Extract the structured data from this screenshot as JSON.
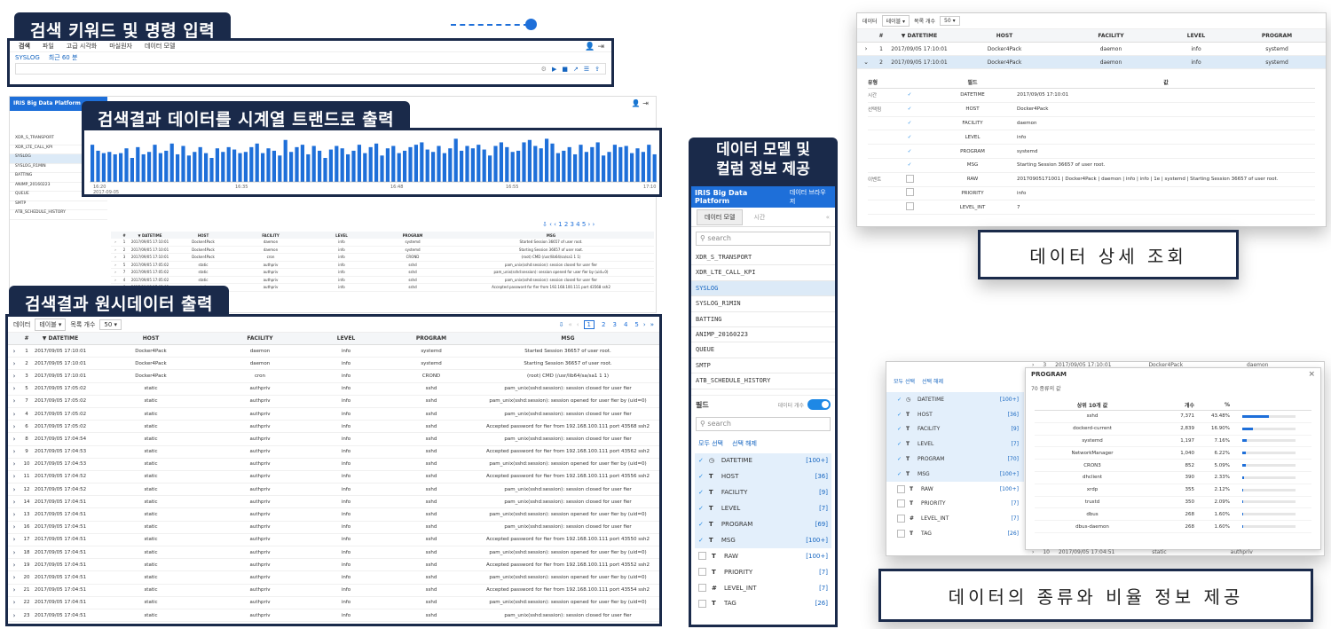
{
  "labels": {
    "search_keyword": "검색 키워드 및 명령 입력",
    "timeseries": "검색결과 데이터를 시계열 트랜드로 출력",
    "raw_output": "검색결과 원시데이터 출력",
    "data_model": "데이터 모델 및\n컬럼 정보 제공",
    "detail_view": "데이터 상세 조회",
    "ratio_info": "데이터의 종류와 비율 정보 제공"
  },
  "search_bar": {
    "menu": [
      "검색",
      "파일",
      "고급 시각화",
      "마실원자",
      "데이터 모델"
    ],
    "tabs": [
      "SYSLOG",
      "최근 60 분"
    ]
  },
  "chart_data": {
    "type": "bar",
    "title": "",
    "x_ticks": [
      "16:20\n2017-09-05",
      "16:35",
      "16:48",
      "16:55",
      "17:10"
    ],
    "values": [
      62,
      52,
      48,
      50,
      46,
      48,
      56,
      40,
      58,
      46,
      50,
      62,
      48,
      52,
      64,
      46,
      60,
      44,
      50,
      58,
      48,
      40,
      56,
      50,
      58,
      54,
      48,
      50,
      58,
      64,
      48,
      56,
      52,
      44,
      70,
      50,
      58,
      62,
      46,
      60,
      52,
      40,
      54,
      60,
      56,
      46,
      52,
      62,
      48,
      58,
      64,
      44,
      56,
      60,
      48,
      52,
      58,
      62,
      66,
      54,
      50,
      60,
      48,
      56,
      72,
      52,
      60,
      56,
      62,
      54,
      44,
      60,
      66,
      58,
      50,
      52,
      66,
      70,
      60,
      56,
      72,
      64,
      48,
      52,
      58,
      46,
      62,
      50,
      58,
      66,
      44,
      50,
      62,
      58,
      60,
      48,
      56,
      50,
      62,
      46
    ],
    "ylim": [
      0,
      80
    ]
  },
  "platform": {
    "logo": "IRIS Big Data Platform",
    "nav": "데이터 브라우저",
    "tabs": [
      "데이터 모델",
      "시간"
    ],
    "search_placeholder": "search",
    "models": [
      "XDR_S_TRANSPORT",
      "XDR_LTE_CALL_KPI",
      "SYSLOG",
      "SYSLOG_R1MIN",
      "BATTING",
      "ANIMP_20160223",
      "QUEUE",
      "SMTP",
      "ATB_SCHEDULE_HISTORY"
    ],
    "field_label": "필드",
    "field_toggle_label": "데이터 개수",
    "select_all": "모두 선택",
    "deselect": "선택 해제",
    "fields": [
      {
        "type": "◷",
        "name": "DATETIME",
        "count": "[100+]",
        "checked": true
      },
      {
        "type": "T",
        "name": "HOST",
        "count": "[36]",
        "checked": true
      },
      {
        "type": "T",
        "name": "FACILITY",
        "count": "[9]",
        "checked": true
      },
      {
        "type": "T",
        "name": "LEVEL",
        "count": "[7]",
        "checked": true
      },
      {
        "type": "T",
        "name": "PROGRAM",
        "count": "[69]",
        "checked": true
      },
      {
        "type": "T",
        "name": "MSG",
        "count": "[100+]",
        "checked": true
      },
      {
        "type": "T",
        "name": "RAW",
        "count": "[100+]",
        "checked": false
      },
      {
        "type": "T",
        "name": "PRIORITY",
        "count": "[7]",
        "checked": false
      },
      {
        "type": "#",
        "name": "LEVEL_INT",
        "count": "[7]",
        "checked": false
      },
      {
        "type": "T",
        "name": "TAG",
        "count": "[26]",
        "checked": false
      }
    ]
  },
  "raw_table": {
    "toolbar": {
      "data_label": "데이터",
      "data_value": "테이블",
      "count_label": "목록 개수",
      "count_value": "50"
    },
    "pages": [
      "1",
      "2",
      "3",
      "4",
      "5"
    ],
    "headers": [
      "#",
      "▼ DATETIME",
      "HOST",
      "FACILITY",
      "LEVEL",
      "PROGRAM",
      "MSG"
    ],
    "rows": [
      [
        "1",
        "2017/09/05 17:10:01",
        "Docker4Pack",
        "daemon",
        "info",
        "systemd",
        "Started Session 36657 of user root."
      ],
      [
        "2",
        "2017/09/05 17:10:01",
        "Docker4Pack",
        "daemon",
        "info",
        "systemd",
        "Starting Session 36657 of user root."
      ],
      [
        "3",
        "2017/09/05 17:10:01",
        "Docker4Pack",
        "cron",
        "info",
        "CROND",
        "(root) CMD (/usr/lib64/sa/sa1 1 1)"
      ],
      [
        "5",
        "2017/09/05 17:05:02",
        "static",
        "authpriv",
        "info",
        "sshd",
        "pam_unix(sshd:session): session closed for user fier"
      ],
      [
        "7",
        "2017/09/05 17:05:02",
        "static",
        "authpriv",
        "info",
        "sshd",
        "pam_unix(sshd:session): session opened for user fier by (uid=0)"
      ],
      [
        "4",
        "2017/09/05 17:05:02",
        "static",
        "authpriv",
        "info",
        "sshd",
        "pam_unix(sshd:session): session closed for user fier"
      ],
      [
        "6",
        "2017/09/05 17:05:02",
        "static",
        "authpriv",
        "info",
        "sshd",
        "Accepted password for fier from 192.168.100.111 port 43568 ssh2"
      ],
      [
        "8",
        "2017/09/05 17:04:54",
        "static",
        "authpriv",
        "info",
        "sshd",
        "pam_unix(sshd:session): session closed for user fier"
      ],
      [
        "9",
        "2017/09/05 17:04:53",
        "static",
        "authpriv",
        "info",
        "sshd",
        "Accepted password for fier from 192.168.100.111 port 43562 ssh2"
      ],
      [
        "10",
        "2017/09/05 17:04:53",
        "static",
        "authpriv",
        "info",
        "sshd",
        "pam_unix(sshd:session): session opened for user fier by (uid=0)"
      ],
      [
        "11",
        "2017/09/05 17:04:52",
        "static",
        "authpriv",
        "info",
        "sshd",
        "Accepted password for fier from 192.168.100.111 port 43556 ssh2"
      ],
      [
        "12",
        "2017/09/05 17:04:52",
        "static",
        "authpriv",
        "info",
        "sshd",
        "pam_unix(sshd:session): session closed for user fier"
      ],
      [
        "14",
        "2017/09/05 17:04:51",
        "static",
        "authpriv",
        "info",
        "sshd",
        "pam_unix(sshd:session): session closed for user fier"
      ],
      [
        "13",
        "2017/09/05 17:04:51",
        "static",
        "authpriv",
        "info",
        "sshd",
        "pam_unix(sshd:session): session opened for user fier by (uid=0)"
      ],
      [
        "16",
        "2017/09/05 17:04:51",
        "static",
        "authpriv",
        "info",
        "sshd",
        "pam_unix(sshd:session): session closed for user fier"
      ],
      [
        "17",
        "2017/09/05 17:04:51",
        "static",
        "authpriv",
        "info",
        "sshd",
        "Accepted password for fier from 192.168.100.111 port 43550 ssh2"
      ],
      [
        "18",
        "2017/09/05 17:04:51",
        "static",
        "authpriv",
        "info",
        "sshd",
        "pam_unix(sshd:session): session opened for user fier by (uid=0)"
      ],
      [
        "19",
        "2017/09/05 17:04:51",
        "static",
        "authpriv",
        "info",
        "sshd",
        "Accepted password for fier from 192.168.100.111 port 43552 ssh2"
      ],
      [
        "20",
        "2017/09/05 17:04:51",
        "static",
        "authpriv",
        "info",
        "sshd",
        "pam_unix(sshd:session): session opened for user fier by (uid=0)"
      ],
      [
        "21",
        "2017/09/05 17:04:51",
        "static",
        "authpriv",
        "info",
        "sshd",
        "Accepted password for fier from 192.168.100.111 port 43554 ssh2"
      ],
      [
        "22",
        "2017/09/05 17:04:51",
        "static",
        "authpriv",
        "info",
        "sshd",
        "pam_unix(sshd:session): session opened for user fier by (uid=0)"
      ],
      [
        "23",
        "2017/09/05 17:04:51",
        "static",
        "authpriv",
        "info",
        "sshd",
        "pam_unix(sshd:session): session closed for user fier"
      ]
    ]
  },
  "detail": {
    "toolbar": {
      "data_label": "데이터",
      "data_value": "테이블",
      "count_label": "목록 개수",
      "count_value": "50"
    },
    "headers": [
      "#",
      "▼ DATETIME",
      "HOST",
      "FACILITY",
      "LEVEL",
      "PROGRAM"
    ],
    "rows": [
      [
        "1",
        "2017/09/05 17:10:01",
        "Docker4Pack",
        "daemon",
        "info",
        "systemd"
      ],
      [
        "2",
        "2017/09/05 17:10:01",
        "Docker4Pack",
        "daemon",
        "info",
        "systemd"
      ]
    ],
    "sub_headers": [
      "유형",
      "필드",
      "값"
    ],
    "sub_rows": [
      {
        "group": "시간",
        "field": "DATETIME",
        "value": "2017/09/05 17:10:01",
        "checked": true
      },
      {
        "group": "선택됨",
        "field": "HOST",
        "value": "Docker4Pack",
        "checked": true
      },
      {
        "group": "",
        "field": "FACILITY",
        "value": "daemon",
        "checked": true
      },
      {
        "group": "",
        "field": "LEVEL",
        "value": "info",
        "checked": true
      },
      {
        "group": "",
        "field": "PROGRAM",
        "value": "systemd",
        "checked": true
      },
      {
        "group": "",
        "field": "MSG",
        "value": "Starting Session 36657 of user root.",
        "checked": true
      },
      {
        "group": "이벤트",
        "field": "RAW",
        "value": "20170905171001 | Docker4Pack | daemon | info | info | 1e | systemd | Starting Session 36657 of user root.",
        "checked": false
      },
      {
        "group": "",
        "field": "PRIORITY",
        "value": "info",
        "checked": false
      },
      {
        "group": "",
        "field": "LEVEL_INT",
        "value": "7",
        "checked": false
      }
    ]
  },
  "ratio": {
    "select_all": "모두 선택",
    "deselect": "선택 해제",
    "bg_row_top": [
      "3",
      "2017/09/05 17:10:01",
      "Docker4Pack",
      "daemon"
    ],
    "bg_row_bottom": [
      "10",
      "2017/09/05 17:04:51",
      "static",
      "authpriv"
    ],
    "fields": [
      {
        "type": "◷",
        "name": "DATETIME",
        "count": "[100+]",
        "checked": true
      },
      {
        "type": "T",
        "name": "HOST",
        "count": "[36]",
        "checked": true
      },
      {
        "type": "T",
        "name": "FACILITY",
        "count": "[9]",
        "checked": true
      },
      {
        "type": "T",
        "name": "LEVEL",
        "count": "[7]",
        "checked": true
      },
      {
        "type": "T",
        "name": "PROGRAM",
        "count": "[70]",
        "checked": true
      },
      {
        "type": "T",
        "name": "MSG",
        "count": "[100+]",
        "checked": true
      },
      {
        "type": "T",
        "name": "RAW",
        "count": "[100+]",
        "checked": false
      },
      {
        "type": "T",
        "name": "PRIORITY",
        "count": "[7]",
        "checked": false
      },
      {
        "type": "#",
        "name": "LEVEL_INT",
        "count": "[7]",
        "checked": false
      },
      {
        "type": "T",
        "name": "TAG",
        "count": "[26]",
        "checked": false
      }
    ],
    "popup_title": "PROGRAM",
    "popup_sub": "70 종류의 값",
    "popup_headers": [
      "상위 10개 값",
      "개수",
      "%"
    ],
    "popup_rows": [
      {
        "name": "sshd",
        "count": "7,371",
        "pct": "43.48%",
        "frac": 0.4348
      },
      {
        "name": "dockerd-current",
        "count": "2,839",
        "pct": "16.90%",
        "frac": 0.169
      },
      {
        "name": "systemd",
        "count": "1,197",
        "pct": "7.16%",
        "frac": 0.0716
      },
      {
        "name": "NetworkManager",
        "count": "1,040",
        "pct": "6.22%",
        "frac": 0.0622
      },
      {
        "name": "CRON3",
        "count": "852",
        "pct": "5.09%",
        "frac": 0.0509
      },
      {
        "name": "dhclient",
        "count": "390",
        "pct": "2.33%",
        "frac": 0.0233
      },
      {
        "name": "xrdp",
        "count": "355",
        "pct": "2.12%",
        "frac": 0.0212
      },
      {
        "name": "trustd",
        "count": "350",
        "pct": "2.09%",
        "frac": 0.0209
      },
      {
        "name": "dbus",
        "count": "268",
        "pct": "1.60%",
        "frac": 0.016
      },
      {
        "name": "dbus-daemon",
        "count": "268",
        "pct": "1.60%",
        "frac": 0.016
      }
    ]
  },
  "bg_window": {
    "logo": "IRIS Big Data Platform",
    "models": [
      "XDR_S_TRANSPORT",
      "XDR_LTE_CALL_KPI",
      "SYSLOG",
      "SYSLOG_R1MIN",
      "BATTING",
      "ANIMP_20160223",
      "QUEUE",
      "SMTP",
      "ATB_SCHEDULE_HISTORY"
    ],
    "headers": [
      "#",
      "▼ DATETIME",
      "HOST",
      "FACILITY",
      "LEVEL",
      "PROGRAM",
      "MSG"
    ],
    "rows": [
      [
        "1",
        "2017/09/05 17:10:01",
        "Docker4Pack",
        "daemon",
        "info",
        "systemd",
        "Started Session 36657 of user root."
      ],
      [
        "2",
        "2017/09/05 17:10:01",
        "Docker4Pack",
        "daemon",
        "info",
        "systemd",
        "Starting Session 36657 of user root."
      ],
      [
        "3",
        "2017/09/05 17:10:01",
        "Docker4Pack",
        "cron",
        "info",
        "CROND",
        "(root) CMD (/usr/lib64/sa/sa1 1 1)"
      ],
      [
        "5",
        "2017/09/05 17:05:02",
        "static",
        "authpriv",
        "info",
        "sshd",
        "pam_unix(sshd:session): session closed for user fier"
      ],
      [
        "7",
        "2017/09/05 17:05:02",
        "static",
        "authpriv",
        "info",
        "sshd",
        "pam_unix(sshd:session): session opened for user fier by (uid=0)"
      ],
      [
        "4",
        "2017/09/05 17:05:02",
        "static",
        "authpriv",
        "info",
        "sshd",
        "pam_unix(sshd:session): session closed for user fier"
      ],
      [
        "6",
        "2017/09/05 17:05:02",
        "static",
        "authpriv",
        "info",
        "sshd",
        "Accepted password for fier from 192.168.100.111 port 43568 ssh2"
      ]
    ]
  }
}
